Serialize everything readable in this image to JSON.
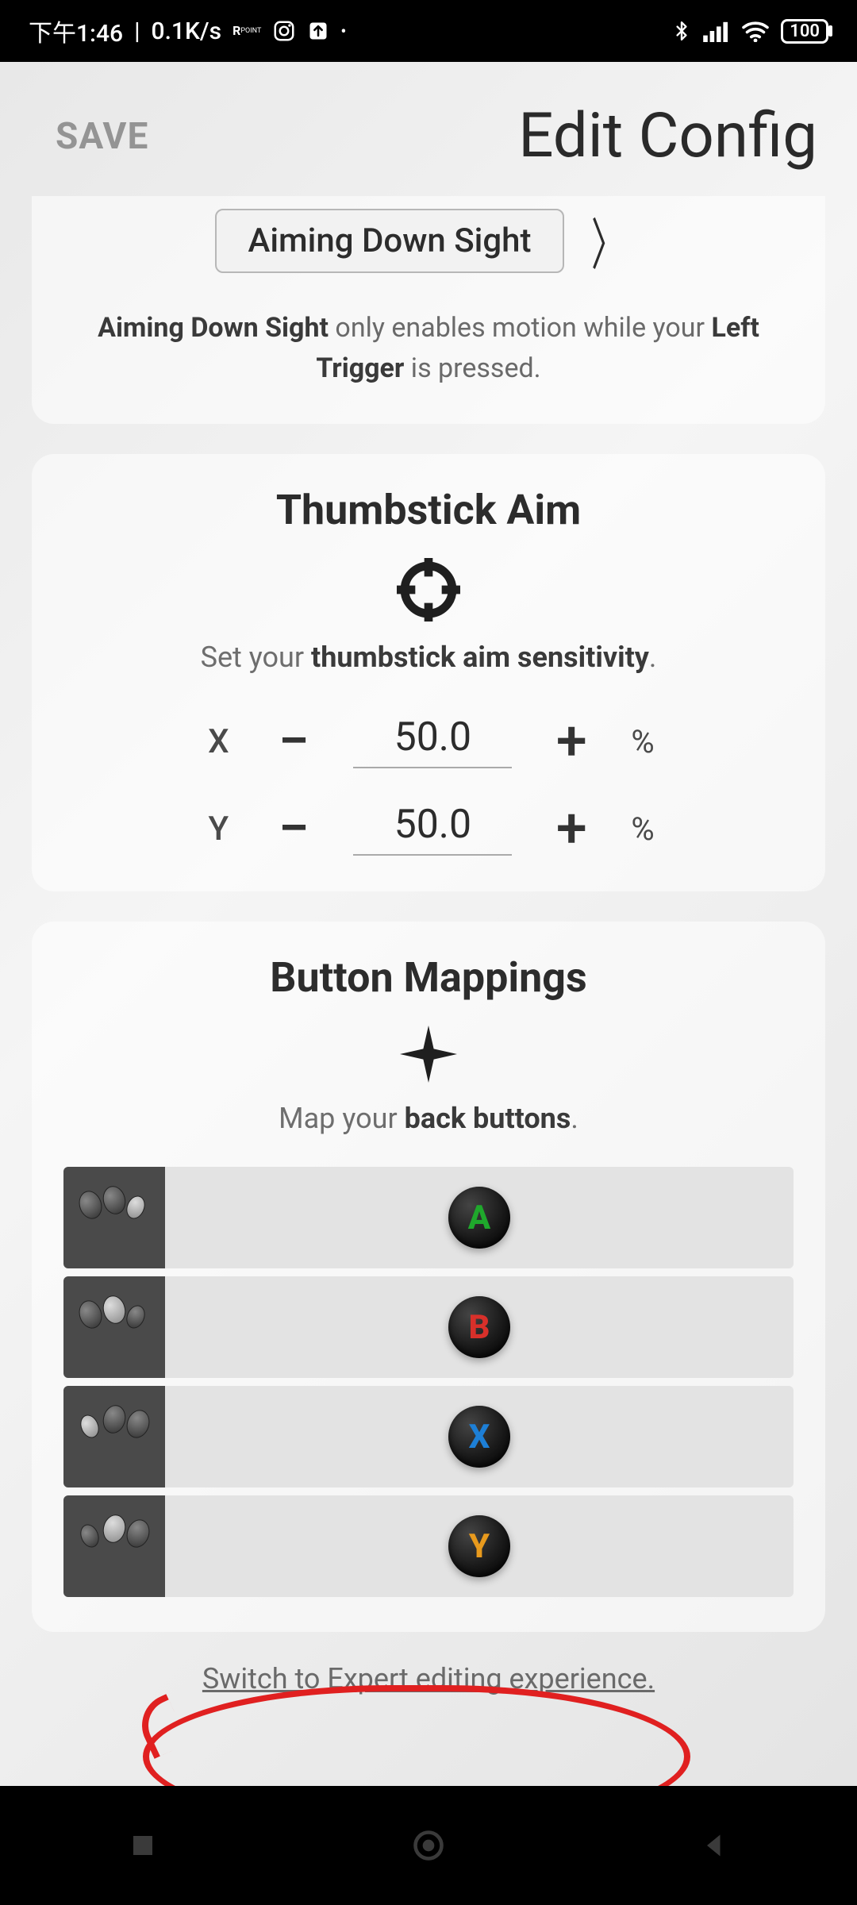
{
  "status": {
    "time": "下午1:46",
    "net_speed": "0.1K/s",
    "battery": "100"
  },
  "header": {
    "save_label": "SAVE",
    "title": "Edit Config"
  },
  "motion": {
    "selected_mode": "Aiming Down Sight",
    "hint_pre": "Aiming Down Sight",
    "hint_mid": " only enables motion while your ",
    "hint_bold2": "Left Trigger",
    "hint_post": " is pressed."
  },
  "thumbstick": {
    "title": "Thumbstick Aim",
    "desc_pre": "Set your ",
    "desc_bold": "thumbstick aim sensitivity",
    "desc_post": ".",
    "axes": {
      "x": {
        "label": "X",
        "value": "50.0",
        "unit": "%"
      },
      "y": {
        "label": "Y",
        "value": "50.0",
        "unit": "%"
      }
    }
  },
  "mappings": {
    "title": "Button Mappings",
    "desc_pre": "Map your ",
    "desc_bold": "back buttons",
    "desc_post": ".",
    "rows": [
      {
        "paddle": "back-paddle-1",
        "button": "A",
        "color": "clr-A"
      },
      {
        "paddle": "back-paddle-2",
        "button": "B",
        "color": "clr-B"
      },
      {
        "paddle": "back-paddle-3",
        "button": "X",
        "color": "clr-X"
      },
      {
        "paddle": "back-paddle-4",
        "button": "Y",
        "color": "clr-Y"
      }
    ]
  },
  "footer": {
    "switch_link": "Switch to Expert editing experience."
  }
}
